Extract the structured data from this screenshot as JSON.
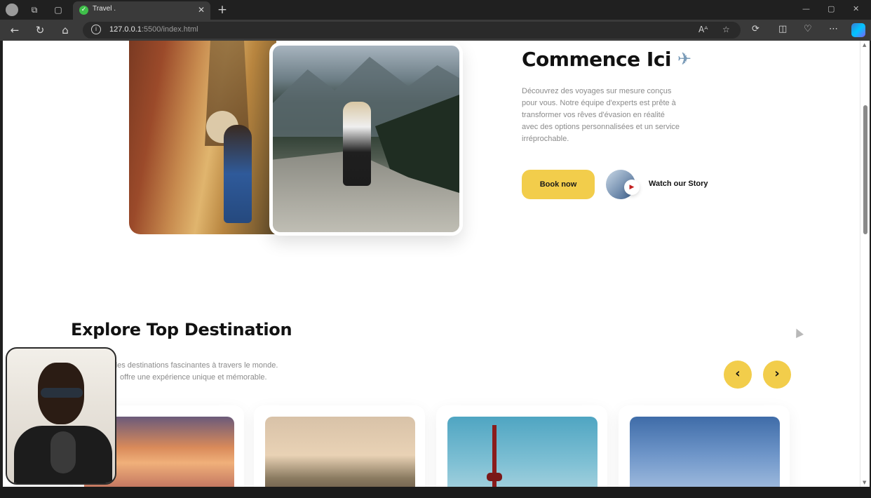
{
  "browser": {
    "tab_title": "Travel .",
    "url_host": "127.0.0.1",
    "url_path": ":5500/index.html"
  },
  "hero": {
    "title": "Commence Ici",
    "description": "Découvrez des voyages sur mesure conçus pour vous. Notre équipe d'experts est prête à transformer vos rêves d'évasion en réalité avec des options personnalisées et un service irréprochable.",
    "book_label": "Book now",
    "story_label": "Watch our Story"
  },
  "explore": {
    "title": "Explore Top Destination",
    "description_line1": "des destinations fascinantes à travers le monde.",
    "description_line2": "offre une expérience unique et mémorable."
  },
  "colors": {
    "accent": "#f2cd4b",
    "text": "#111111",
    "muted": "#8b8b8b"
  },
  "icons": {
    "prev": "chevron-left",
    "next": "chevron-right",
    "play": "play",
    "plane": "airplane"
  }
}
